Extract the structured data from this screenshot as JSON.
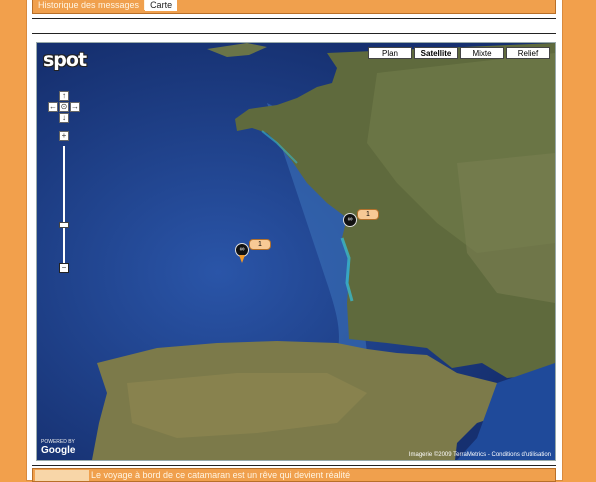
{
  "topbar": {
    "tabs": [
      {
        "label": "Historique des messages"
      },
      {
        "label": "Carte"
      }
    ]
  },
  "map": {
    "types": [
      "Plan",
      "Satellite",
      "Mixte",
      "Relief"
    ],
    "selected_type": "Satellite",
    "logo_text": "spot",
    "nav": {
      "pan_up": "↑",
      "pan_left": "←",
      "pan_center": "⊙",
      "pan_right": "→",
      "pan_down": "↓",
      "zoom_in": "+",
      "zoom_out": "−"
    },
    "markers": [
      {
        "count": "1"
      },
      {
        "count": "1"
      }
    ],
    "google_label": "Google",
    "google_prefix": "POWERED BY",
    "attribution": "Imagerie ©2009 TerraMetrics - Conditions d'utilisation"
  },
  "bottombar": {
    "text": "Le voyage à bord de ce catamaran est un rêve qui devient réalité"
  },
  "colors": {
    "background": "#f2a04c",
    "bar": "#f0a04d",
    "sea": "#1f3f88",
    "land": "#5f6a3d"
  }
}
